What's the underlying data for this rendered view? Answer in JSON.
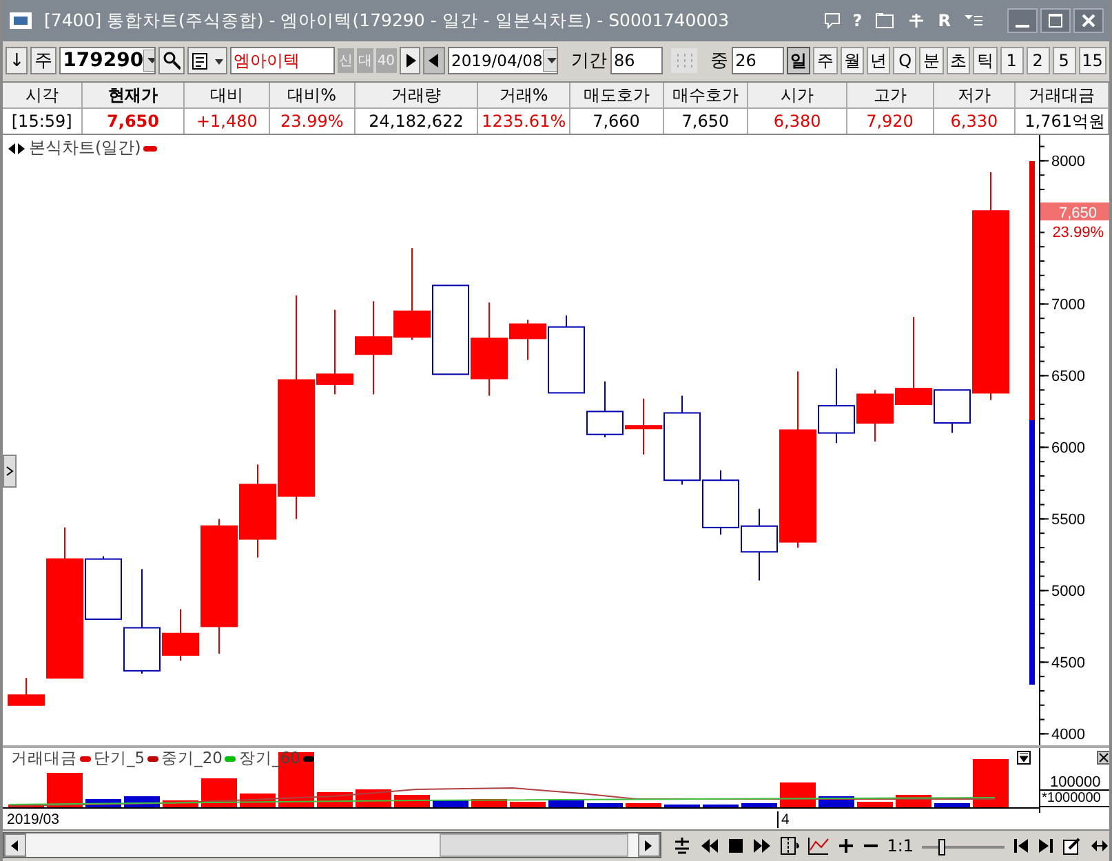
{
  "window": {
    "title": "[7400] 통합차트(주식종합) - 엠아이텍(179290 - 일간 - 일본식차트) - S0001740003",
    "tool_glyphs": [
      "?",
      "R"
    ]
  },
  "toolbar": {
    "direction_button": "↓",
    "market_select": "주",
    "code_field": "179290",
    "name_field": "엠아이텍",
    "name_badges": [
      "신",
      "대",
      "40"
    ],
    "date_field": "2019/04/08",
    "period_label": "기간",
    "period_field": "86",
    "middle_label": "중",
    "middle_field": "26",
    "intervals": [
      {
        "label": "일",
        "selected": true
      },
      {
        "label": "주",
        "selected": false
      },
      {
        "label": "월",
        "selected": false
      },
      {
        "label": "년",
        "selected": false
      },
      {
        "label": "Q",
        "selected": false
      },
      {
        "label": "분",
        "selected": false
      },
      {
        "label": "초",
        "selected": false
      },
      {
        "label": "틱",
        "selected": false
      },
      {
        "label": "1",
        "selected": false
      },
      {
        "label": "2",
        "selected": false
      },
      {
        "label": "5",
        "selected": false
      },
      {
        "label": "15",
        "selected": false
      }
    ]
  },
  "quote_table": {
    "columns": [
      {
        "label": "시각",
        "bold": false
      },
      {
        "label": "현재가",
        "bold": true
      },
      {
        "label": "대비",
        "bold": false
      },
      {
        "label": "대비%",
        "bold": false
      },
      {
        "label": "거래량",
        "bold": false
      },
      {
        "label": "거래%",
        "bold": false
      },
      {
        "label": "매도호가",
        "bold": false
      },
      {
        "label": "매수호가",
        "bold": false
      },
      {
        "label": "시가",
        "bold": false
      },
      {
        "label": "고가",
        "bold": false
      },
      {
        "label": "저가",
        "bold": false
      },
      {
        "label": "거래대금",
        "bold": false
      }
    ],
    "values": [
      {
        "text": "[15:59]",
        "color": "#000000"
      },
      {
        "text": "7,650",
        "color": "#e00000"
      },
      {
        "text": "+1,480",
        "color": "#e00000"
      },
      {
        "text": "23.99%",
        "color": "#e00000"
      },
      {
        "text": "24,182,622",
        "color": "#000000"
      },
      {
        "text": "1235.61%",
        "color": "#e00000"
      },
      {
        "text": "7,660",
        "color": "#000000"
      },
      {
        "text": "7,650",
        "color": "#000000"
      },
      {
        "text": "6,380",
        "color": "#e00000"
      },
      {
        "text": "7,920",
        "color": "#e00000"
      },
      {
        "text": "6,330",
        "color": "#e00000"
      },
      {
        "text": "1,761억원",
        "color": "#000000"
      }
    ]
  },
  "price_chart": {
    "legend": "본식차트(일간)",
    "current_price_tag": "7,650",
    "change_tag": "23.99%",
    "axis_labels": [
      "8000",
      "7000",
      "6500",
      "6000",
      "5500",
      "5000",
      "4500",
      "4000"
    ]
  },
  "volume_chart": {
    "legend": [
      {
        "label": "거래대금",
        "color": "#e00000"
      },
      {
        "label": "단기_5",
        "color": "#c00000"
      },
      {
        "label": "중기_20",
        "color": "#00c000"
      },
      {
        "label": "장기_60",
        "color": "#000000"
      }
    ],
    "axis_label": "100000",
    "unit_label": "*1000000"
  },
  "date_axis": [
    "2019/03",
    "4"
  ],
  "bottom_toolbar": {
    "zoom_label": "1:1",
    "zoom_slider": {
      "level": 0.22
    }
  }
}
